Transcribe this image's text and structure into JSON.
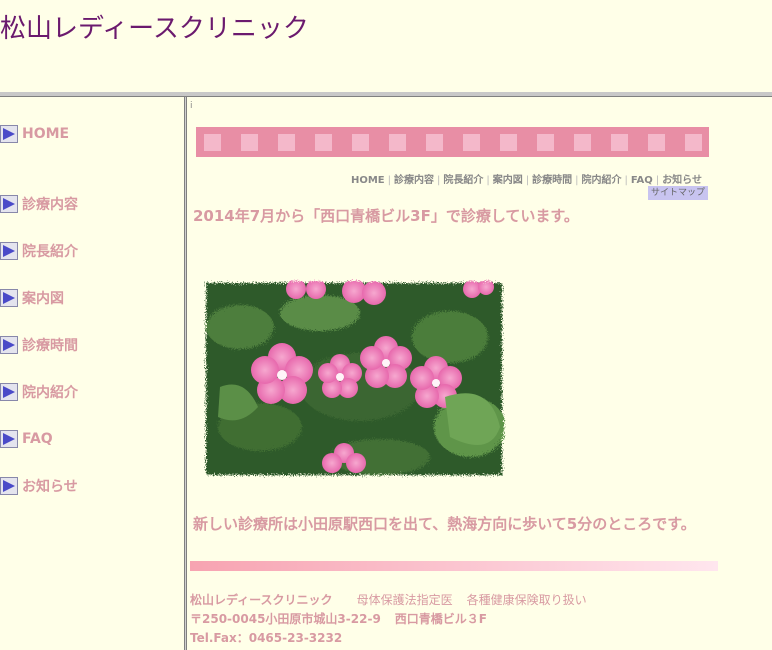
{
  "header": {
    "site_title": "松山レディースクリニック"
  },
  "sidebar": {
    "items": [
      {
        "label": "HOME"
      },
      {
        "label": "診療内容"
      },
      {
        "label": "院長紹介"
      },
      {
        "label": "案内図"
      },
      {
        "label": "診療時間"
      },
      {
        "label": "院内紹介"
      },
      {
        "label": "FAQ"
      },
      {
        "label": "お知らせ"
      }
    ],
    "label_color": "#D89AA2",
    "arrow_icon": "play-arrow-icon"
  },
  "main": {
    "frame_marker": "i",
    "top_nav": [
      "HOME",
      "診療内容",
      "院長紹介",
      "案内図",
      "診療時間",
      "院内紹介",
      "FAQ",
      "お知らせ"
    ],
    "sitemap": "サイトマップ",
    "notice": "2014年7月から「西口青橋ビル3F」で診療しています。",
    "directions": "新しい診療所は小田原駅西口を出て、熱海方向に歩いて5分のところです。",
    "photo_icon": "flower-photo"
  },
  "footer": {
    "clinic_name": "松山レディースクリニック",
    "designation": "母体保護法指定医",
    "insurance": "各種健康保険取り扱い",
    "address": "〒250-0045小田原市城山3-22-9",
    "building": "西口青橋ビル３F",
    "tel": "Tel.Fax：0465-23-3232"
  },
  "colors": {
    "background": "#FFFFE8",
    "title": "#6B1A6E",
    "text_pink": "#D89AA2",
    "pattern_bar": "#E88EA5",
    "pattern_square": "#F4B8CA",
    "sitemap_bg": "#C8C4F0"
  }
}
